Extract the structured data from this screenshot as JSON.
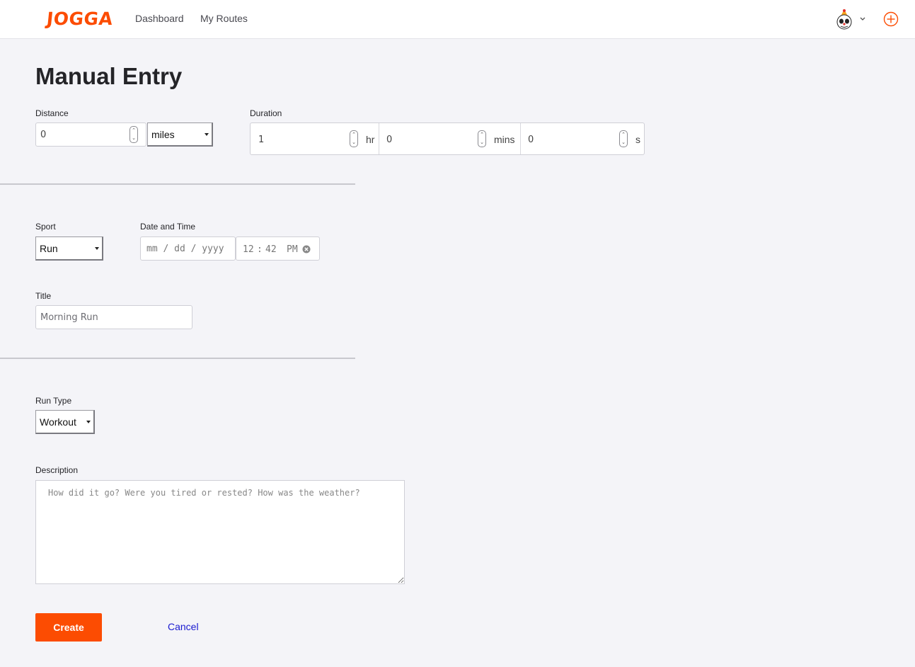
{
  "header": {
    "logo": "JOGGA",
    "nav": [
      {
        "label": "Dashboard"
      },
      {
        "label": "My Routes"
      }
    ],
    "brand_color": "#fc4c02",
    "avatar_icon": "avatar-icon",
    "menu_icon": "chevron-down-icon",
    "add_icon": "plus-circle-icon"
  },
  "page": {
    "title": "Manual Entry"
  },
  "form": {
    "distance": {
      "label": "Distance",
      "value": "0",
      "unit": "miles"
    },
    "duration": {
      "label": "Duration",
      "hours": "1",
      "hours_unit": "hr",
      "minutes": "0",
      "minutes_unit": "mins",
      "seconds": "0",
      "seconds_unit": "s"
    },
    "sport": {
      "label": "Sport",
      "value": "Run"
    },
    "date_time": {
      "label": "Date and Time",
      "date_placeholder": "mm / dd / yyyy",
      "time_hour": "12",
      "time_sep": ":",
      "time_minute": "42",
      "time_ampm": "PM"
    },
    "title_field": {
      "label": "Title",
      "placeholder": "Morning Run"
    },
    "run_type": {
      "label": "Run Type",
      "value": "Workout"
    },
    "description": {
      "label": "Description",
      "placeholder": "How did it go? Were you tired or rested? How was the weather?"
    },
    "create_label": "Create",
    "cancel_label": "Cancel"
  }
}
